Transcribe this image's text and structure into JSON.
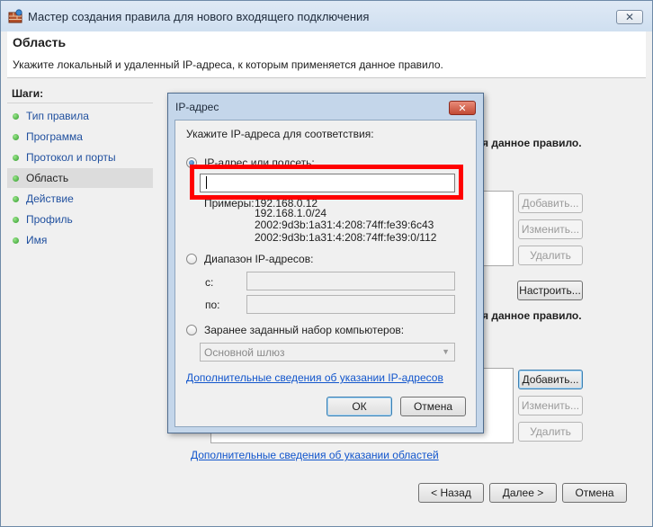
{
  "window": {
    "title": "Мастер создания правила для нового входящего подключения",
    "close_glyph": "✕"
  },
  "header": {
    "title": "Область",
    "subtitle": "Укажите локальный и удаленный IP-адреса, к которым применяется данное правило."
  },
  "steps": {
    "heading": "Шаги:",
    "items": [
      {
        "label": "Тип правила",
        "current": false
      },
      {
        "label": "Программа",
        "current": false
      },
      {
        "label": "Протокол и порты",
        "current": false
      },
      {
        "label": "Область",
        "current": true
      },
      {
        "label": "Действие",
        "current": false
      },
      {
        "label": "Профиль",
        "current": false
      },
      {
        "label": "Имя",
        "current": false
      }
    ]
  },
  "background": {
    "local_heading_fragment": "я данное правило.",
    "remote_heading_fragment": "я данное правило.",
    "local_buttons": {
      "add": "Добавить...",
      "edit": "Изменить...",
      "remove": "Удалить"
    },
    "configure_button": "Настроить...",
    "remote_buttons": {
      "add": "Добавить...",
      "edit": "Изменить...",
      "remove": "Удалить"
    },
    "link": "Дополнительные сведения об указании областей",
    "nav": {
      "back": "< Назад",
      "next": "Далее >",
      "cancel": "Отмена"
    }
  },
  "dialog": {
    "title": "IP-адрес",
    "close_glyph": "✕",
    "instruction": "Укажите IP-адреса для соответствия:",
    "option_ip": "IP-адрес или подсеть:",
    "ip_value": "",
    "examples_label": "Примеры:",
    "examples": [
      "192.168.0.12",
      "192.168.1.0/24",
      "2002:9d3b:1a31:4:208:74ff:fe39:6c43",
      "2002:9d3b:1a31:4:208:74ff:fe39:0/112"
    ],
    "option_range": "Диапазон IP-адресов:",
    "range_from_label": "с:",
    "range_to_label": "по:",
    "option_preset": "Заранее заданный набор компьютеров:",
    "preset_value": "Основной шлюз",
    "link": "Дополнительные сведения об указании IP-адресов",
    "ok": "ОК",
    "cancel": "Отмена"
  },
  "colors": {
    "highlight": "#ff0000",
    "link": "#1155cc",
    "step_bullet": "#2f9a2a"
  }
}
